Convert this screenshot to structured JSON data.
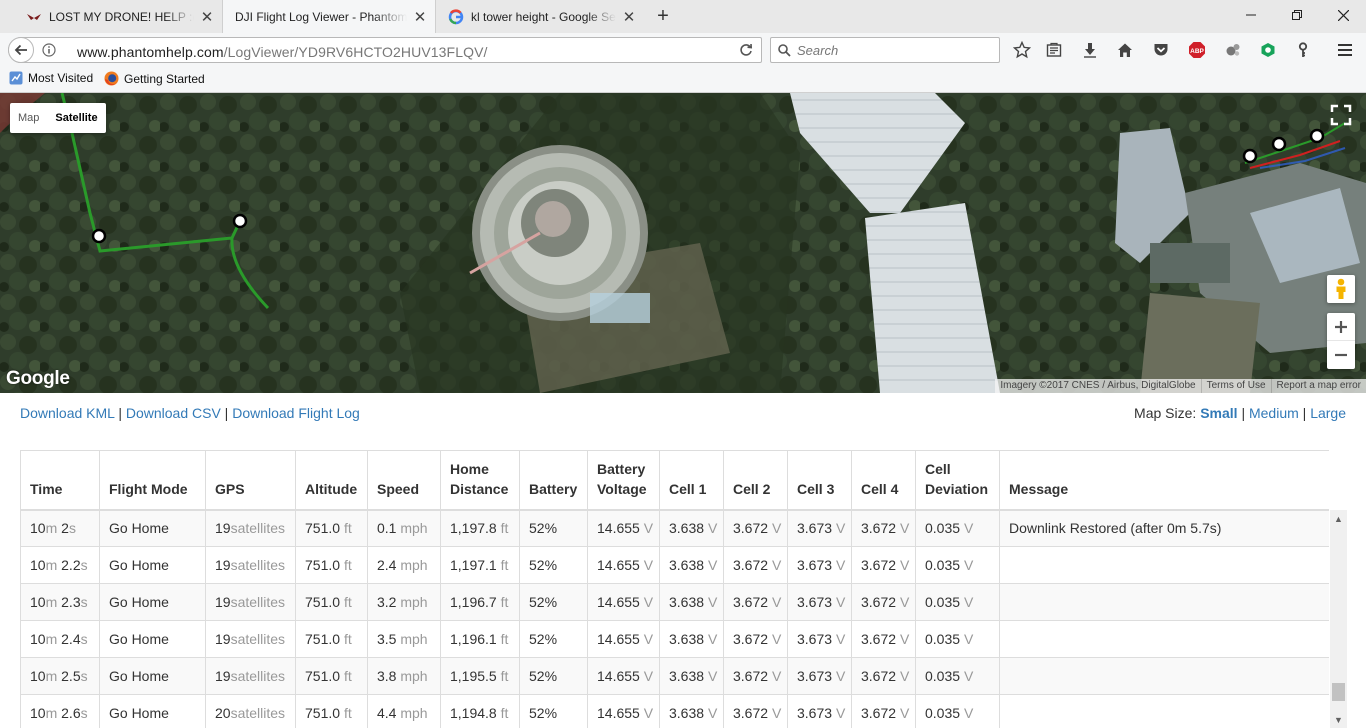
{
  "browser": {
    "tabs": [
      {
        "title": "LOST MY DRONE! HELP :( | D",
        "active": false
      },
      {
        "title": "DJI Flight Log Viewer - Phantom",
        "active": true
      },
      {
        "title": "kl tower height - Google Sea",
        "active": false
      }
    ],
    "url_host": "www.phantomhelp.com",
    "url_path": "/LogViewer/YD9RV6HCTO2HUV13FLQV/",
    "search_placeholder": "Search",
    "bookmarks": [
      "Most Visited",
      "Getting Started"
    ]
  },
  "map": {
    "type_buttons": [
      "Map",
      "Satellite"
    ],
    "selected_type": "Satellite",
    "logo": "Google",
    "attribution": [
      "Imagery ©2017 CNES / Airbus, DigitalGlobe",
      "Terms of Use",
      "Report a map error"
    ]
  },
  "downloads": [
    "Download KML",
    "Download CSV",
    "Download Flight Log"
  ],
  "map_size": {
    "label": "Map Size:",
    "options": [
      "Small",
      "Medium",
      "Large"
    ],
    "selected": "Small"
  },
  "table": {
    "headers": [
      "Time",
      "Flight Mode",
      "GPS",
      "Altitude",
      "Speed",
      "Home Distance",
      "Battery",
      "Battery Voltage",
      "Cell 1",
      "Cell 2",
      "Cell 3",
      "Cell 4",
      "Cell Deviation",
      "Message"
    ],
    "units": {
      "gps": "satellites",
      "altitude": "ft",
      "speed": "mph",
      "distance": "ft",
      "voltage": "V"
    },
    "rows": [
      {
        "min": "10",
        "sec": "2",
        "mode": "Go Home",
        "gps": "19",
        "alt": "751.0",
        "speed": "0.1",
        "dist": "1,197.8",
        "battery": "52%",
        "volt": "14.655",
        "c1": "3.638",
        "c2": "3.672",
        "c3": "3.673",
        "c4": "3.672",
        "dev": "0.035",
        "msg": "Downlink Restored (after 0m 5.7s)"
      },
      {
        "min": "10",
        "sec": "2.2",
        "mode": "Go Home",
        "gps": "19",
        "alt": "751.0",
        "speed": "2.4",
        "dist": "1,197.1",
        "battery": "52%",
        "volt": "14.655",
        "c1": "3.638",
        "c2": "3.672",
        "c3": "3.673",
        "c4": "3.672",
        "dev": "0.035",
        "msg": ""
      },
      {
        "min": "10",
        "sec": "2.3",
        "mode": "Go Home",
        "gps": "19",
        "alt": "751.0",
        "speed": "3.2",
        "dist": "1,196.7",
        "battery": "52%",
        "volt": "14.655",
        "c1": "3.638",
        "c2": "3.672",
        "c3": "3.673",
        "c4": "3.672",
        "dev": "0.035",
        "msg": ""
      },
      {
        "min": "10",
        "sec": "2.4",
        "mode": "Go Home",
        "gps": "19",
        "alt": "751.0",
        "speed": "3.5",
        "dist": "1,196.1",
        "battery": "52%",
        "volt": "14.655",
        "c1": "3.638",
        "c2": "3.672",
        "c3": "3.673",
        "c4": "3.672",
        "dev": "0.035",
        "msg": ""
      },
      {
        "min": "10",
        "sec": "2.5",
        "mode": "Go Home",
        "gps": "19",
        "alt": "751.0",
        "speed": "3.8",
        "dist": "1,195.5",
        "battery": "52%",
        "volt": "14.655",
        "c1": "3.638",
        "c2": "3.672",
        "c3": "3.673",
        "c4": "3.672",
        "dev": "0.035",
        "msg": ""
      },
      {
        "min": "10",
        "sec": "2.6",
        "mode": "Go Home",
        "gps": "20",
        "alt": "751.0",
        "speed": "4.4",
        "dist": "1,194.8",
        "battery": "52%",
        "volt": "14.655",
        "c1": "3.638",
        "c2": "3.672",
        "c3": "3.673",
        "c4": "3.672",
        "dev": "0.035",
        "msg": ""
      }
    ]
  }
}
